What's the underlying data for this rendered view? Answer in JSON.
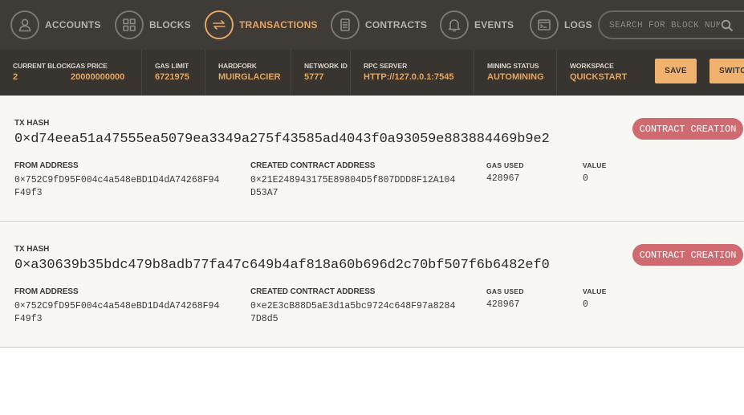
{
  "nav": {
    "items": [
      {
        "label": "ACCOUNTS",
        "icon": "user-icon"
      },
      {
        "label": "BLOCKS",
        "icon": "blocks-grid-icon"
      },
      {
        "label": "TRANSACTIONS",
        "icon": "transfer-arrows-icon"
      },
      {
        "label": "CONTRACTS",
        "icon": "document-icon"
      },
      {
        "label": "EVENTS",
        "icon": "bell-icon"
      },
      {
        "label": "LOGS",
        "icon": "terminal-icon"
      }
    ],
    "active": "TRANSACTIONS",
    "search_placeholder": "SEARCH FOR BLOCK NUMBERS OR TX HASHES"
  },
  "status": {
    "current_block": {
      "label": "CURRENT BLOCK",
      "value": "2"
    },
    "gas_price": {
      "label": "GAS PRICE",
      "value": "20000000000"
    },
    "gas_limit": {
      "label": "GAS LIMIT",
      "value": "6721975"
    },
    "hardfork": {
      "label": "HARDFORK",
      "value": "MUIRGLACIER"
    },
    "network_id": {
      "label": "NETWORK ID",
      "value": "5777"
    },
    "rpc_server": {
      "label": "RPC SERVER",
      "value": "HTTP://127.0.0.1:7545"
    },
    "mining_status": {
      "label": "MINING STATUS",
      "value": "AUTOMINING"
    },
    "workspace": {
      "label": "WORKSPACE",
      "value": "QUICKSTART"
    },
    "save_label": "SAVE",
    "switch_label": "SWITCH"
  },
  "labels": {
    "tx_hash": "TX HASH",
    "from_address": "FROM ADDRESS",
    "created_contract_address": "CREATED CONTRACT ADDRESS",
    "gas_used": "GAS USED",
    "value": "VALUE"
  },
  "transactions": [
    {
      "hash": "0×d74eea51a47555ea5079ea3349a275f43585ad4043f0a93059e883884469b9e2",
      "from": "0×752C9fD95F004c4a548eBD1D4dA74268F94\nF49f3",
      "created_contract": "0×21E248943175E89804D5f807DDD8F12A104\nD53A7",
      "gas_used": "428967",
      "value": "0",
      "badge": "CONTRACT CREATION"
    },
    {
      "hash": "0×a30639b35bdc479b8adb77fa47c649b4af818a60b696d2c70bf507f6b6482ef0",
      "from": "0×752C9fD95F004c4a548eBD1D4dA74268F94\nF49f3",
      "created_contract": "0×e2E3cB88D5aE3d1a5bc9724c648F97a8284\n7D8d5",
      "gas_used": "428967",
      "value": "0",
      "badge": "CONTRACT CREATION"
    }
  ],
  "colors": {
    "accent": "#e4a663",
    "nav_bg": "#3f3b37",
    "status_bg": "#38342f",
    "badge_bg": "#ce6a70",
    "button_bg": "#f1b26d"
  }
}
